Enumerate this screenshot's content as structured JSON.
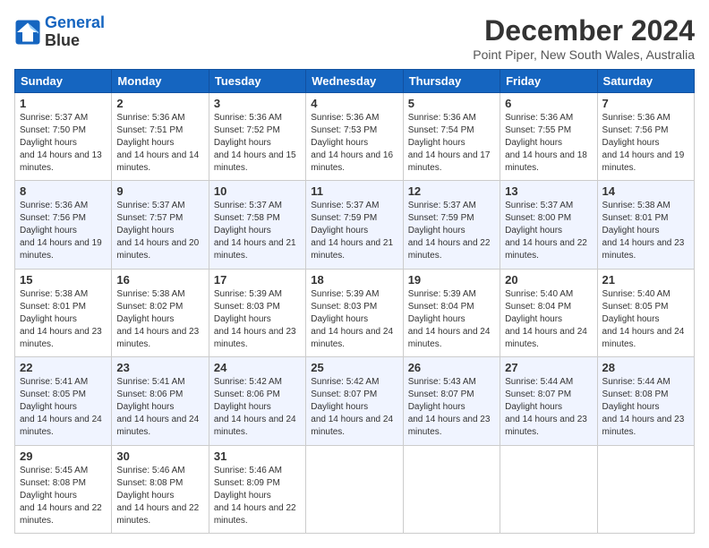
{
  "logo": {
    "line1": "General",
    "line2": "Blue"
  },
  "title": "December 2024",
  "location": "Point Piper, New South Wales, Australia",
  "weekdays": [
    "Sunday",
    "Monday",
    "Tuesday",
    "Wednesday",
    "Thursday",
    "Friday",
    "Saturday"
  ],
  "weeks": [
    [
      {
        "day": "1",
        "rise": "5:37 AM",
        "set": "7:50 PM",
        "hours": "14 hours and 13 minutes."
      },
      {
        "day": "2",
        "rise": "5:36 AM",
        "set": "7:51 PM",
        "hours": "14 hours and 14 minutes."
      },
      {
        "day": "3",
        "rise": "5:36 AM",
        "set": "7:52 PM",
        "hours": "14 hours and 15 minutes."
      },
      {
        "day": "4",
        "rise": "5:36 AM",
        "set": "7:53 PM",
        "hours": "14 hours and 16 minutes."
      },
      {
        "day": "5",
        "rise": "5:36 AM",
        "set": "7:54 PM",
        "hours": "14 hours and 17 minutes."
      },
      {
        "day": "6",
        "rise": "5:36 AM",
        "set": "7:55 PM",
        "hours": "14 hours and 18 minutes."
      },
      {
        "day": "7",
        "rise": "5:36 AM",
        "set": "7:56 PM",
        "hours": "14 hours and 19 minutes."
      }
    ],
    [
      {
        "day": "8",
        "rise": "5:36 AM",
        "set": "7:56 PM",
        "hours": "14 hours and 19 minutes."
      },
      {
        "day": "9",
        "rise": "5:37 AM",
        "set": "7:57 PM",
        "hours": "14 hours and 20 minutes."
      },
      {
        "day": "10",
        "rise": "5:37 AM",
        "set": "7:58 PM",
        "hours": "14 hours and 21 minutes."
      },
      {
        "day": "11",
        "rise": "5:37 AM",
        "set": "7:59 PM",
        "hours": "14 hours and 21 minutes."
      },
      {
        "day": "12",
        "rise": "5:37 AM",
        "set": "7:59 PM",
        "hours": "14 hours and 22 minutes."
      },
      {
        "day": "13",
        "rise": "5:37 AM",
        "set": "8:00 PM",
        "hours": "14 hours and 22 minutes."
      },
      {
        "day": "14",
        "rise": "5:38 AM",
        "set": "8:01 PM",
        "hours": "14 hours and 23 minutes."
      }
    ],
    [
      {
        "day": "15",
        "rise": "5:38 AM",
        "set": "8:01 PM",
        "hours": "14 hours and 23 minutes."
      },
      {
        "day": "16",
        "rise": "5:38 AM",
        "set": "8:02 PM",
        "hours": "14 hours and 23 minutes."
      },
      {
        "day": "17",
        "rise": "5:39 AM",
        "set": "8:03 PM",
        "hours": "14 hours and 23 minutes."
      },
      {
        "day": "18",
        "rise": "5:39 AM",
        "set": "8:03 PM",
        "hours": "14 hours and 24 minutes."
      },
      {
        "day": "19",
        "rise": "5:39 AM",
        "set": "8:04 PM",
        "hours": "14 hours and 24 minutes."
      },
      {
        "day": "20",
        "rise": "5:40 AM",
        "set": "8:04 PM",
        "hours": "14 hours and 24 minutes."
      },
      {
        "day": "21",
        "rise": "5:40 AM",
        "set": "8:05 PM",
        "hours": "14 hours and 24 minutes."
      }
    ],
    [
      {
        "day": "22",
        "rise": "5:41 AM",
        "set": "8:05 PM",
        "hours": "14 hours and 24 minutes."
      },
      {
        "day": "23",
        "rise": "5:41 AM",
        "set": "8:06 PM",
        "hours": "14 hours and 24 minutes."
      },
      {
        "day": "24",
        "rise": "5:42 AM",
        "set": "8:06 PM",
        "hours": "14 hours and 24 minutes."
      },
      {
        "day": "25",
        "rise": "5:42 AM",
        "set": "8:07 PM",
        "hours": "14 hours and 24 minutes."
      },
      {
        "day": "26",
        "rise": "5:43 AM",
        "set": "8:07 PM",
        "hours": "14 hours and 23 minutes."
      },
      {
        "day": "27",
        "rise": "5:44 AM",
        "set": "8:07 PM",
        "hours": "14 hours and 23 minutes."
      },
      {
        "day": "28",
        "rise": "5:44 AM",
        "set": "8:08 PM",
        "hours": "14 hours and 23 minutes."
      }
    ],
    [
      {
        "day": "29",
        "rise": "5:45 AM",
        "set": "8:08 PM",
        "hours": "14 hours and 22 minutes."
      },
      {
        "day": "30",
        "rise": "5:46 AM",
        "set": "8:08 PM",
        "hours": "14 hours and 22 minutes."
      },
      {
        "day": "31",
        "rise": "5:46 AM",
        "set": "8:09 PM",
        "hours": "14 hours and 22 minutes."
      },
      null,
      null,
      null,
      null
    ]
  ]
}
